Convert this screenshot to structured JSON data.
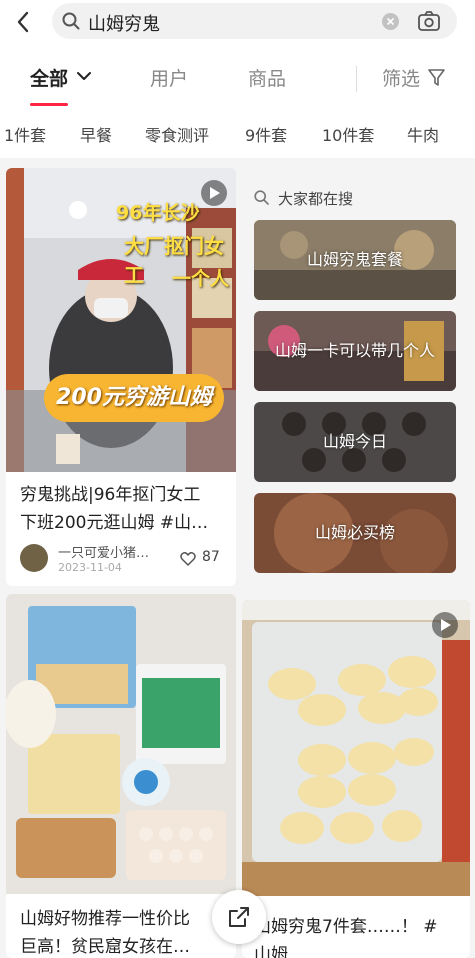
{
  "search": {
    "query": "山姆穷鬼"
  },
  "tabs": [
    {
      "label": "全部"
    },
    {
      "label": "用户"
    },
    {
      "label": "商品"
    },
    {
      "label": "筛选"
    }
  ],
  "chips": [
    "1件套",
    "早餐",
    "零食测评",
    "9件套",
    "10件套",
    "牛肉"
  ],
  "feed": {
    "card1": {
      "overlay_line1": "96年长沙",
      "overlay_line2": "大厂抠门女工",
      "overlay_line3": "一个人",
      "overlay_big": "200元穷游山姆",
      "title_line1": "穷鬼挑战|96年抠门女工",
      "title_line2": "下班200元逛山姆 #山…",
      "author": "一只可爱小猪…",
      "date": "2023-11-04",
      "likes": "87"
    },
    "card2": {
      "title_line1": "山姆好物推荐一性价比",
      "title_line2": "巨高！贫民窟女孩在…"
    },
    "card3": {
      "title_line1": "山姆穷鬼7件套……！ #",
      "title_line2": "山姆"
    }
  },
  "hot_search": {
    "heading": "大家都在搜",
    "items": [
      "山姆穷鬼套餐",
      "山姆一卡可以带几个人",
      "山姆今日",
      "山姆必买榜"
    ]
  },
  "colors": {
    "accent": "#ff2442",
    "overlay_yellow": "#ffde44",
    "bubble_orange": "#f7b531"
  }
}
